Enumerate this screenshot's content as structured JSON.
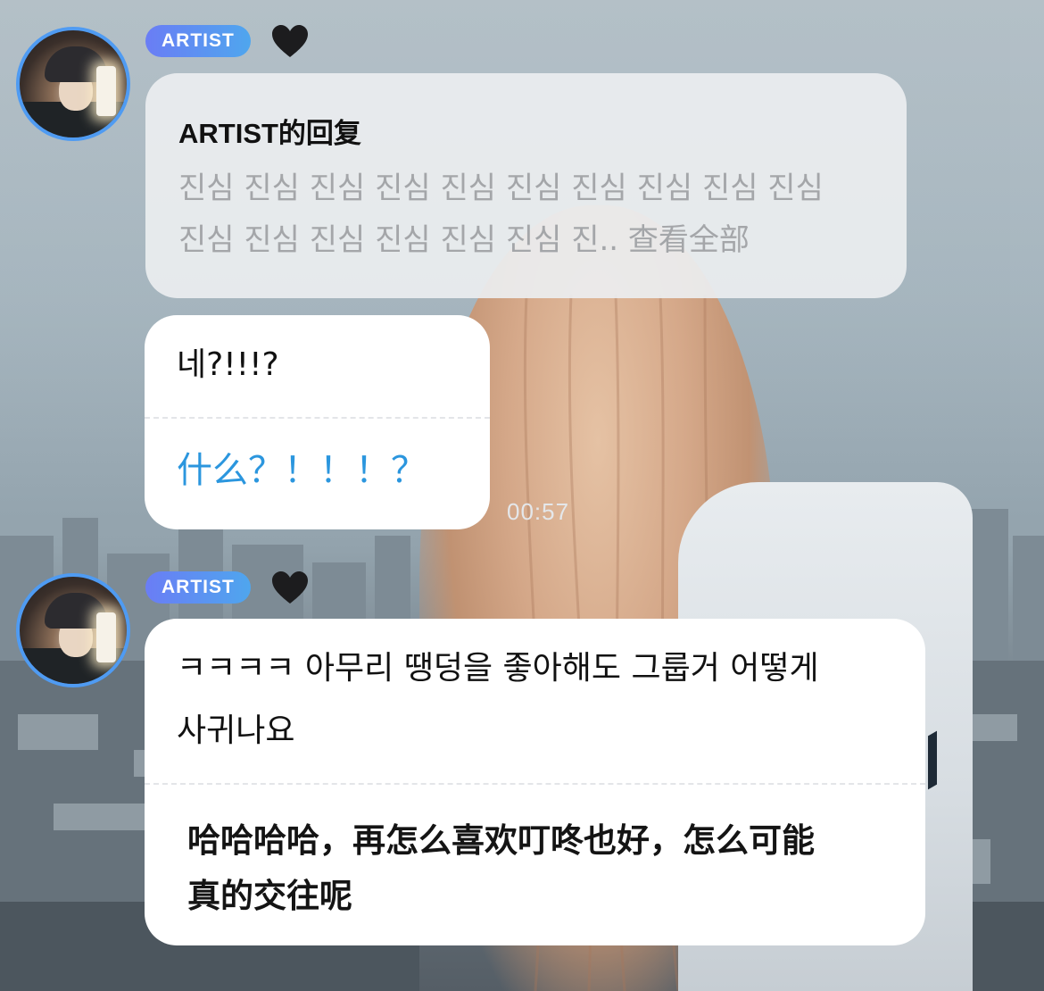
{
  "messages": [
    {
      "badge": "ARTIST",
      "heart": "black-heart",
      "reply": {
        "title": "ARTIST的回复",
        "preview_line1": "진심 진심 진심 진심 진심 진심 진심 진심 진심 진심",
        "preview_line2": "진심 진심 진심 진심 진심 진심 진..",
        "view_all": "查看全部"
      },
      "text": "네?!!!?",
      "translation": "什么？！！！？"
    },
    {
      "badge": "ARTIST",
      "heart": "black-heart",
      "text_line1": "ㅋㅋㅋㅋ 아무리 땡덩을 좋아해도 그룹거 어떻게",
      "text_line2": "사귀나요",
      "translation_line1": "哈哈哈哈，再怎么喜欢叮咚也好，怎么可能",
      "translation_line2": "真的交往呢"
    }
  ],
  "timestamp": "00:57",
  "colors": {
    "avatar_ring": "#4f9bf2",
    "badge_start": "#6a7df5",
    "badge_end": "#4fa6ee",
    "translation_blue": "#2b96de"
  }
}
